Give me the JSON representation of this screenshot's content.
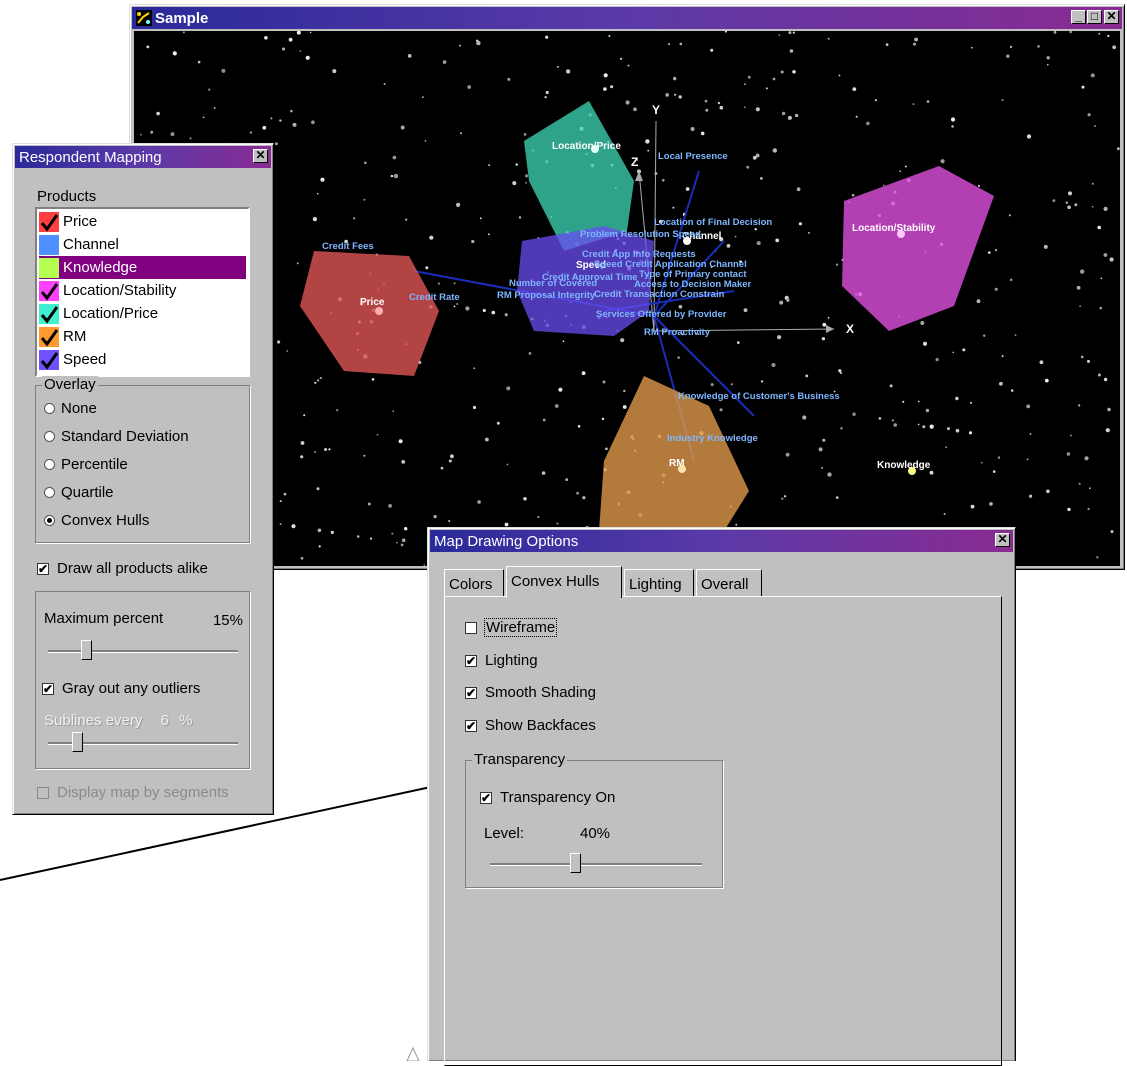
{
  "sample_window": {
    "title": "Sample",
    "labels": {
      "location_price": "Location/Price",
      "location_stability": "Location/Stability",
      "price": "Price",
      "rm": "RM",
      "knowledge": "Knowledge",
      "speed": "Speed",
      "channel": "Channel",
      "local_presence": "Local Presence",
      "credit_fees": "Credit Fees",
      "credit_rate": "Credit Rate",
      "location_final": "Location of Final Decision",
      "problem_resolution": "Problem Resolution Speed",
      "credit_app_requests": "Credit App Info Requests",
      "speed_credit": "Speed Credit Application Channel",
      "number_covered": "Number of Covered",
      "rm_proposal": "RM Proposal Integrity",
      "credit_approval": "Credit Approval Time",
      "primary_contact": "Type of Primary contact",
      "access_decision": "Access to Decision Maker",
      "credit_transaction": "Credit Transaction Constrain",
      "services_offered": "Services Offered by Provider",
      "rm_proactivity": "RM Proactivity",
      "knowledge_customer": "Knowledge of Customer's Business",
      "industry_knowledge": "Industry Knowledge",
      "axis_x": "X",
      "axis_y": "Y",
      "axis_z": "Z"
    }
  },
  "respondent_mapping": {
    "title": "Respondent Mapping",
    "products_label": "Products",
    "products": [
      {
        "label": "Price",
        "color": "#ff4040",
        "checked": true
      },
      {
        "label": "Channel",
        "color": "#4f8fff",
        "checked": false
      },
      {
        "label": "Knowledge",
        "color": "#b4ff50",
        "checked": false
      },
      {
        "label": "Location/Stability",
        "color": "#ff40ff",
        "checked": true
      },
      {
        "label": "Location/Price",
        "color": "#40f0d0",
        "checked": true
      },
      {
        "label": "RM",
        "color": "#ff9a30",
        "checked": true
      },
      {
        "label": "Speed",
        "color": "#7050ff",
        "checked": true
      }
    ],
    "selected_index": 2,
    "overlay": {
      "legend": "Overlay",
      "options": [
        "None",
        "Standard Deviation",
        "Percentile",
        "Quartile",
        "Convex Hulls"
      ],
      "selected": "Convex Hulls"
    },
    "draw_all_alike": {
      "label": "Draw all products alike",
      "checked": true
    },
    "max_percent": {
      "label": "Maximum percent",
      "value": "15%",
      "level": 0.2
    },
    "gray_outliers": {
      "label": "Gray out any outliers",
      "checked": true
    },
    "sublines": {
      "label": "Sublines every",
      "value": "6",
      "unit": "%",
      "level": 0.15
    },
    "display_segments": {
      "label": "Display map by segments",
      "checked": false
    }
  },
  "map_options": {
    "title": "Map Drawing Options",
    "tabs": [
      "Colors",
      "Convex Hulls",
      "Lighting",
      "Overall"
    ],
    "active_tab": "Convex Hulls",
    "wireframe": {
      "label": "Wireframe",
      "checked": false
    },
    "lighting": {
      "label": "Lighting",
      "checked": true
    },
    "smooth": {
      "label": "Smooth Shading",
      "checked": true
    },
    "backfaces": {
      "label": "Show Backfaces",
      "checked": true
    },
    "transparency": {
      "legend": "Transparency",
      "on": {
        "label": "Transparency On",
        "checked": true
      },
      "level_label": "Level:",
      "level_value": "40%",
      "level": 0.4
    }
  },
  "check_mark": "✔",
  "close_glyph": "✕",
  "minimize_glyph": "_",
  "maximize_glyph": "□"
}
